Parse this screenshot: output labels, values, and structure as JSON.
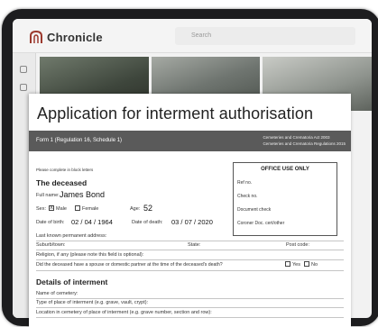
{
  "app": {
    "brand": "Chronicle",
    "search_placeholder": "Search"
  },
  "form": {
    "title": "Application for interment authorisation",
    "banner_left": "Form 1 (Regulation 16, Schedule 1)",
    "banner_right_line1": "Cemeteries and Crematoria Act 2003",
    "banner_right_line2": "Cemeteries and Crematoria Regulations 2015",
    "note": "Please complete in block letters",
    "office": {
      "title": "OFFICE USE ONLY",
      "rows": [
        "Ref no.",
        "Check no.",
        "Document check",
        "Coroner Doc. cert/other"
      ]
    },
    "deceased": {
      "heading": "The deceased",
      "full_name_label": "Full name:",
      "full_name": "James Bond",
      "sex_label": "Sex:",
      "male_label": "Male",
      "male_checked": "X",
      "female_label": "Female",
      "age_label": "Age:",
      "age": "52",
      "dob_label": "Date of birth:",
      "dob": "02 / 04 / 1964",
      "dod_label": "Date of death:",
      "dod": "03 / 07 / 2020",
      "address_label": "Last known permanent address:",
      "suburb_label": "Suburb/town:",
      "state_label": "State:",
      "postcode_label": "Post code:",
      "religion_label": "Religion, if any (please note this field is optional):",
      "spouse_question": "Did the deceased have a spouse or domestic partner at the time of the deceased's death?",
      "yes_label": "Yes",
      "no_label": "No"
    },
    "interment": {
      "heading": "Details of interment",
      "cemetery_label": "Name of cemetery:",
      "type_label": "Type of place of interment (e.g. grave, vault, crypt):",
      "location_label": "Location in cemetery of place of interment (e.g. grave number, section and row):"
    }
  }
}
